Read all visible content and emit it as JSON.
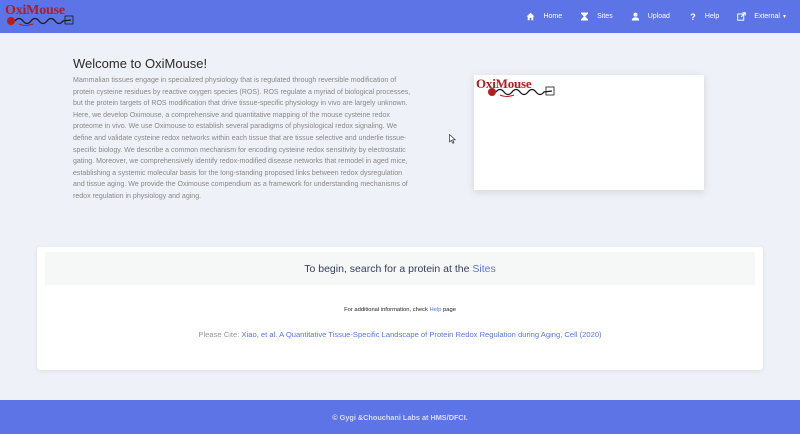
{
  "brand": {
    "name": "OxiMouse",
    "accent": "#5c74e6",
    "logo_red": "#b51c1c"
  },
  "nav": [
    {
      "label": "Home",
      "icon": "home-icon"
    },
    {
      "label": "Sites",
      "icon": "hourglass-icon"
    },
    {
      "label": "Upload",
      "icon": "upload-user-icon"
    },
    {
      "label": "Help",
      "icon": "question-icon"
    },
    {
      "label": "External",
      "icon": "external-link-icon",
      "dropdown": true
    }
  ],
  "welcome": {
    "title": "Welcome to OxiMouse!",
    "body": "Mammalian tissues engage in specialized physiology that is regulated through reversible modification of protein cysteine residues by reactive oxygen species (ROS). ROS regulate a myriad of biological processes, but the protein targets of ROS modification that drive tissue-specific physiology in vivo are largely unknown. Here, we develop Oximouse, a comprehensive and quantitative mapping of the mouse cysteine redox proteome in vivo. We use Oximouse to establish several paradigms of physiological redox signaling. We define and validate cysteine redox networks within each tissue that are tissue selective and underlie tissue-specific biology. We describe a common mechanism for encoding cysteine redox sensitivity by electrostatic gating. Moreover, we comprehensively identify redox-modified disease networks that remodel in aged mice, establishing a systemic molecular basis for the long-standing proposed links between redox dysregulation and tissue aging. We provide the Oximouse compendium as a framework for understanding mechanisms of redox regulation in physiology and aging."
  },
  "search": {
    "prompt": "To begin, search for a protein at the",
    "link": "Sites"
  },
  "info": {
    "prefix": "For additional information, check",
    "link": "Help",
    "suffix": "page"
  },
  "cite": {
    "prefix": "Please Cite:",
    "link": "Xiao, et al. A Quantitative Tissue-Specific Landscape of Protein Redox Regulation during Aging, Cell (2020)"
  },
  "footer": {
    "text": "© Gygi &Chouchani Labs at HMS/DFCI."
  }
}
